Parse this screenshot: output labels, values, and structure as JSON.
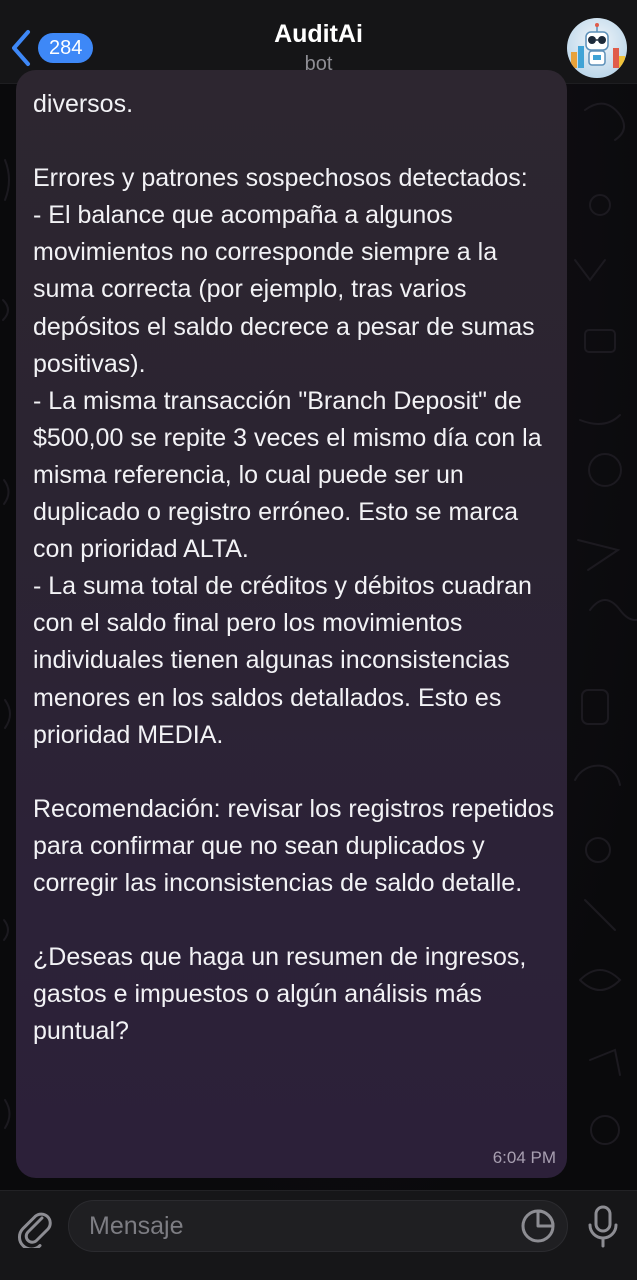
{
  "header": {
    "back_badge": "284",
    "title": "AuditAi",
    "subtitle": "bot",
    "avatar_icon": "robot-avatar-icon"
  },
  "message": {
    "text": "diversos.\n\nErrores y patrones sospechosos detectados:\n- El balance que acompaña a algunos movimientos no corresponde siempre a la suma correcta (por ejemplo, tras varios depósitos el saldo decrece a pesar de sumas positivas).\n- La misma transacción \"Branch Deposit\" de $500,00 se repite 3 veces el mismo día con la misma referencia, lo cual puede ser un duplicado o registro erróneo. Esto se marca con prioridad ALTA.\n- La suma total de créditos y débitos cuadran con el saldo final pero los movimientos individuales tienen algunas inconsistencias menores en los saldos detallados. Esto es prioridad MEDIA.\n\nRecomendación: revisar los registros repetidos para confirmar que no sean duplicados y corregir las inconsistencias de saldo detalle.\n\n¿Deseas que haga un resumen de ingresos, gastos e impuestos o algún análisis más puntual?",
    "time": "6:04 PM"
  },
  "input": {
    "placeholder": "Mensaje",
    "value": ""
  },
  "colors": {
    "accent": "#3e88f7",
    "bubble": "#2c2434",
    "background": "#0b0b0d"
  }
}
